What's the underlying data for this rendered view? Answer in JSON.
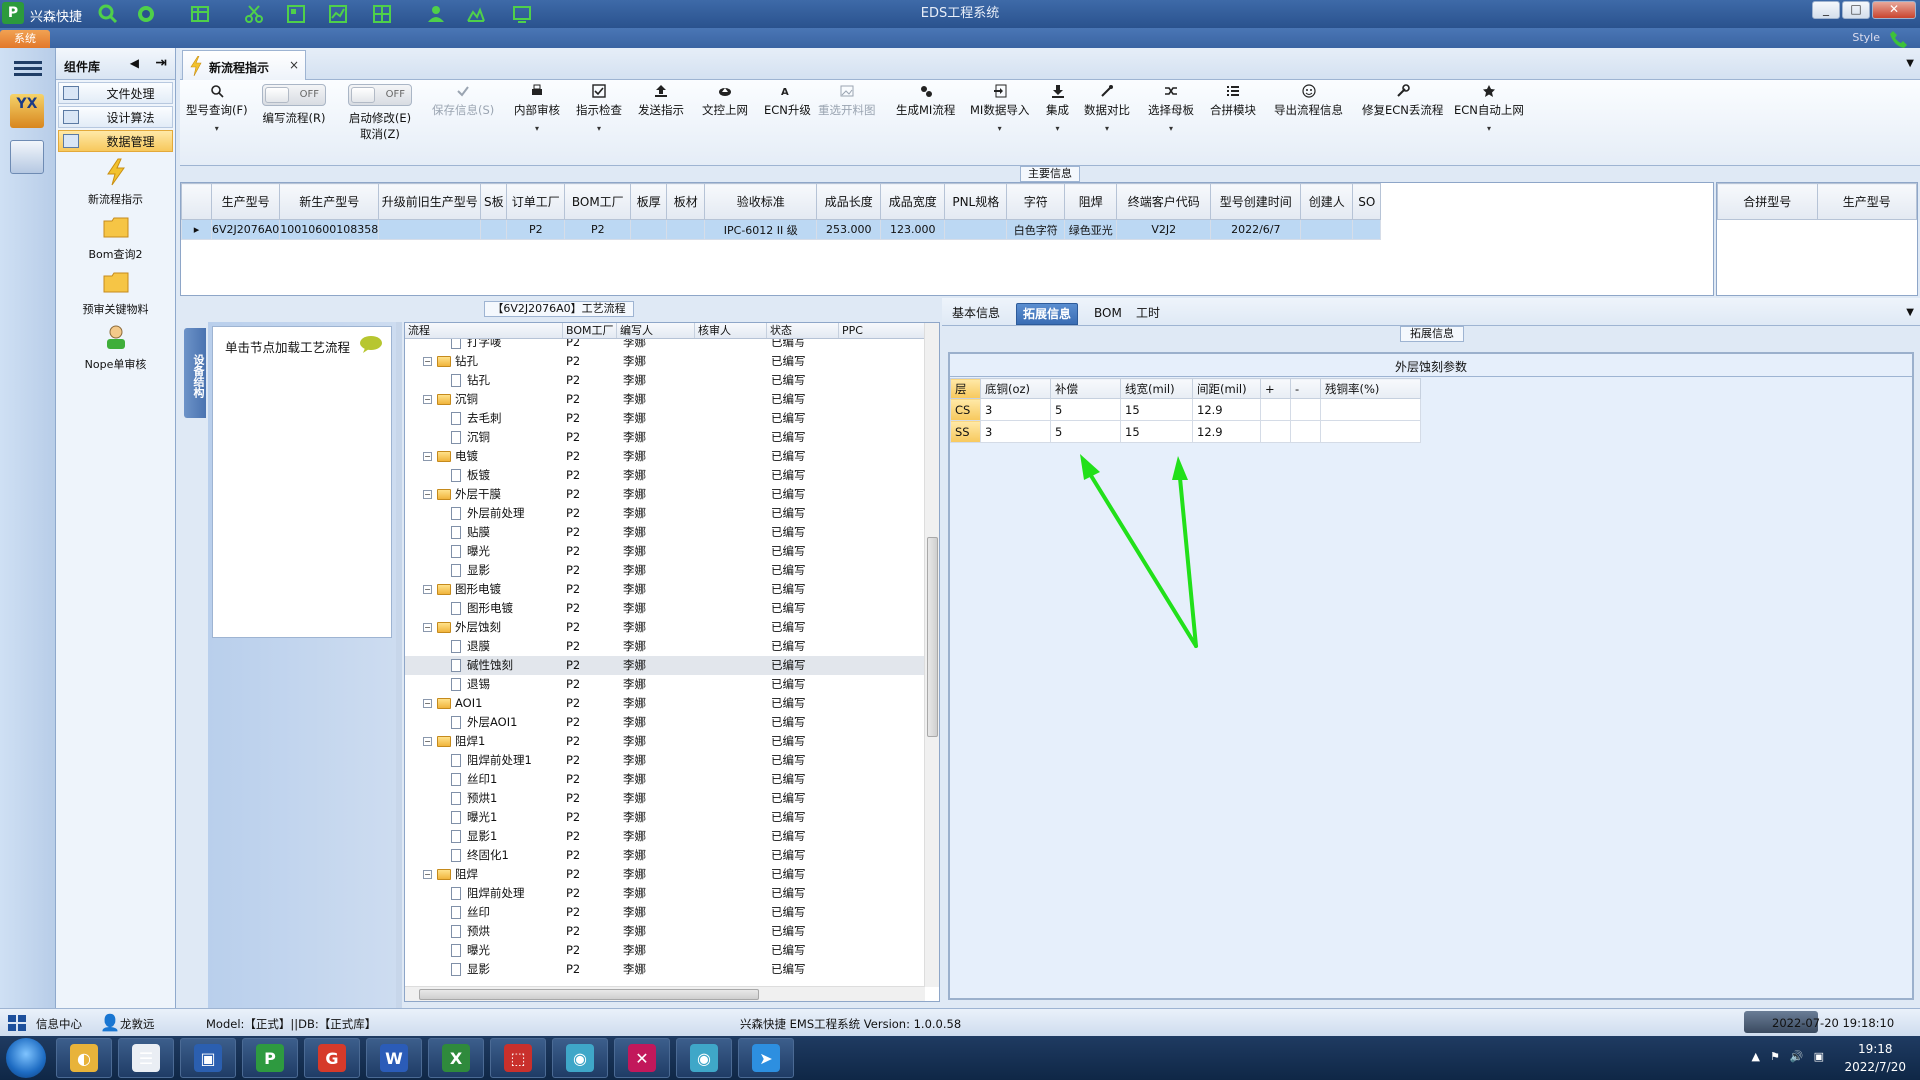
{
  "window": {
    "app_name": "兴森快捷",
    "title": "EDS工程系统",
    "min": "_",
    "max": "□",
    "close": "✕",
    "system_tab": "系统",
    "style_label": "Style"
  },
  "rail": {
    "logo_text": "YX"
  },
  "component_panel": {
    "title": "组件库",
    "collapse": "◀",
    "pin": "⇥",
    "nav": [
      {
        "label": "文件处理"
      },
      {
        "label": "设计算法"
      },
      {
        "label": "数据管理"
      }
    ],
    "items": [
      {
        "label": "新流程指示"
      },
      {
        "label": "Bom查询2"
      },
      {
        "label": "预审关键物料"
      },
      {
        "label": "Nope单审核"
      }
    ]
  },
  "doc_tab": {
    "label": "新流程指示",
    "close": "×",
    "dropdown": "▼"
  },
  "toolbar": {
    "items": [
      {
        "label": "型号查询(F)",
        "caret": "▾"
      },
      {
        "label": "编写流程(R)",
        "toggle": "OFF"
      },
      {
        "label": "启动修改(E)",
        "label2": "取消(Z)",
        "toggle": "OFF"
      },
      {
        "label": "保存信息(S)"
      },
      {
        "label": "内部审核",
        "caret": "▾"
      },
      {
        "label": "指示检查",
        "caret": "▾"
      },
      {
        "label": "发送指示"
      },
      {
        "label": "文控上网"
      },
      {
        "label": "ECN升级"
      },
      {
        "label": "重选开料图"
      },
      {
        "label": "生成MI流程"
      },
      {
        "label": "MI数据导入",
        "caret": "▾"
      },
      {
        "label": "集成",
        "caret": "▾"
      },
      {
        "label": "数据对比",
        "caret": "▾"
      },
      {
        "label": "选择母板",
        "caret": "▾"
      },
      {
        "label": "合拼模块"
      },
      {
        "label": "导出流程信息"
      },
      {
        "label": "修复ECN丢流程"
      },
      {
        "label": "ECN自动上网",
        "caret": "▾"
      }
    ]
  },
  "main_info": {
    "title": "主要信息",
    "columns": [
      "生产型号",
      "新生产型号",
      "升级前旧生产型号",
      "S板",
      "订单工厂",
      "BOM工厂",
      "板厚",
      "板材",
      "验收标准",
      "成品长度",
      "成品宽度",
      "PNL规格",
      "字符",
      "阻焊",
      "终端客户代码",
      "型号创建时间",
      "创建人",
      "SO"
    ],
    "rows": [
      [
        "6V2J2076A0",
        "10010600108358",
        "",
        "",
        "P2",
        "P2",
        "",
        "",
        "IPC-6012 II 级",
        "253.000",
        "123.000",
        "",
        "白色字符",
        "绿色亚光",
        "V2J2",
        "2022/6/7",
        "",
        ""
      ]
    ],
    "side_columns": [
      "合拼型号",
      "生产型号"
    ]
  },
  "process": {
    "title": "【6V2J2076A0】工艺流程",
    "side_tab": "设备结构",
    "hint": "单击节点加载工艺流程",
    "columns": [
      "流程",
      "BOM工厂",
      "编写人",
      "核审人",
      "状态",
      "PPC"
    ],
    "rows": [
      {
        "name": "打字唛",
        "level": 2,
        "bom": "P2",
        "writer": "李娜",
        "status": "已编写"
      },
      {
        "name": "钻孔",
        "level": 1,
        "bom": "P2",
        "writer": "李娜",
        "status": "已编写"
      },
      {
        "name": "钻孔",
        "level": 2,
        "bom": "P2",
        "writer": "李娜",
        "status": "已编写"
      },
      {
        "name": "沉铜",
        "level": 1,
        "bom": "P2",
        "writer": "李娜",
        "status": "已编写"
      },
      {
        "name": "去毛刺",
        "level": 2,
        "bom": "P2",
        "writer": "李娜",
        "status": "已编写"
      },
      {
        "name": "沉铜",
        "level": 2,
        "bom": "P2",
        "writer": "李娜",
        "status": "已编写"
      },
      {
        "name": "电镀",
        "level": 1,
        "bom": "P2",
        "writer": "李娜",
        "status": "已编写"
      },
      {
        "name": "板镀",
        "level": 2,
        "bom": "P2",
        "writer": "李娜",
        "status": "已编写"
      },
      {
        "name": "外层干膜",
        "level": 1,
        "bom": "P2",
        "writer": "李娜",
        "status": "已编写"
      },
      {
        "name": "外层前处理",
        "level": 2,
        "bom": "P2",
        "writer": "李娜",
        "status": "已编写"
      },
      {
        "name": "贴膜",
        "level": 2,
        "bom": "P2",
        "writer": "李娜",
        "status": "已编写"
      },
      {
        "name": "曝光",
        "level": 2,
        "bom": "P2",
        "writer": "李娜",
        "status": "已编写"
      },
      {
        "name": "显影",
        "level": 2,
        "bom": "P2",
        "writer": "李娜",
        "status": "已编写"
      },
      {
        "name": "图形电镀",
        "level": 1,
        "bom": "P2",
        "writer": "李娜",
        "status": "已编写"
      },
      {
        "name": "图形电镀",
        "level": 2,
        "bom": "P2",
        "writer": "李娜",
        "status": "已编写"
      },
      {
        "name": "外层蚀刻",
        "level": 1,
        "bom": "P2",
        "writer": "李娜",
        "status": "已编写"
      },
      {
        "name": "退膜",
        "level": 2,
        "bom": "P2",
        "writer": "李娜",
        "status": "已编写"
      },
      {
        "name": "碱性蚀刻",
        "level": 2,
        "bom": "P2",
        "writer": "李娜",
        "status": "已编写",
        "selected": true
      },
      {
        "name": "退锡",
        "level": 2,
        "bom": "P2",
        "writer": "李娜",
        "status": "已编写"
      },
      {
        "name": "AOI1",
        "level": 1,
        "bom": "P2",
        "writer": "李娜",
        "status": "已编写"
      },
      {
        "name": "外层AOI1",
        "level": 2,
        "bom": "P2",
        "writer": "李娜",
        "status": "已编写"
      },
      {
        "name": "阻焊1",
        "level": 1,
        "bom": "P2",
        "writer": "李娜",
        "status": "已编写"
      },
      {
        "name": "阻焊前处理1",
        "level": 2,
        "bom": "P2",
        "writer": "李娜",
        "status": "已编写"
      },
      {
        "name": "丝印1",
        "level": 2,
        "bom": "P2",
        "writer": "李娜",
        "status": "已编写"
      },
      {
        "name": "预烘1",
        "level": 2,
        "bom": "P2",
        "writer": "李娜",
        "status": "已编写"
      },
      {
        "name": "曝光1",
        "level": 2,
        "bom": "P2",
        "writer": "李娜",
        "status": "已编写"
      },
      {
        "name": "显影1",
        "level": 2,
        "bom": "P2",
        "writer": "李娜",
        "status": "已编写"
      },
      {
        "name": "终固化1",
        "level": 2,
        "bom": "P2",
        "writer": "李娜",
        "status": "已编写"
      },
      {
        "name": "阻焊",
        "level": 1,
        "bom": "P2",
        "writer": "李娜",
        "status": "已编写"
      },
      {
        "name": "阻焊前处理",
        "level": 2,
        "bom": "P2",
        "writer": "李娜",
        "status": "已编写"
      },
      {
        "name": "丝印",
        "level": 2,
        "bom": "P2",
        "writer": "李娜",
        "status": "已编写"
      },
      {
        "name": "预烘",
        "level": 2,
        "bom": "P2",
        "writer": "李娜",
        "status": "已编写"
      },
      {
        "name": "曝光",
        "level": 2,
        "bom": "P2",
        "writer": "李娜",
        "status": "已编写"
      },
      {
        "name": "显影",
        "level": 2,
        "bom": "P2",
        "writer": "李娜",
        "status": "已编写"
      }
    ]
  },
  "right_tabs": {
    "tabs": [
      {
        "label": "基本信息"
      },
      {
        "label": "拓展信息",
        "active": true
      },
      {
        "label": "BOM"
      },
      {
        "label": "工时"
      }
    ],
    "dropdown": "▼"
  },
  "extended": {
    "title": "拓展信息",
    "section": "外层蚀刻参数",
    "columns": [
      "层",
      "底铜(oz)",
      "补偿",
      "线宽(mil)",
      "间距(mil)",
      "+",
      "-",
      "残铜率(%)"
    ],
    "rows": [
      [
        "CS",
        "3",
        "5",
        "15",
        "12.9",
        "",
        "",
        ""
      ],
      [
        "SS",
        "3",
        "5",
        "15",
        "12.9",
        "",
        "",
        ""
      ]
    ],
    "arrow_color": "#22e01a"
  },
  "statusbar": {
    "info_center": "信息中心",
    "user": "龙敦远",
    "model": "Model:【正式】||DB:【正式库】",
    "version": "兴森快捷 EMS工程系统 Version: 1.0.0.58",
    "datetime": "2022-07-20 19:18:10"
  },
  "taskbar": {
    "apps": [
      "shell",
      "notepad",
      "save",
      "P",
      "G",
      "W",
      "X",
      "PDF",
      "eye",
      "X2",
      "eye2",
      "arrow"
    ],
    "time": "19:18",
    "date": "2022/7/20"
  }
}
